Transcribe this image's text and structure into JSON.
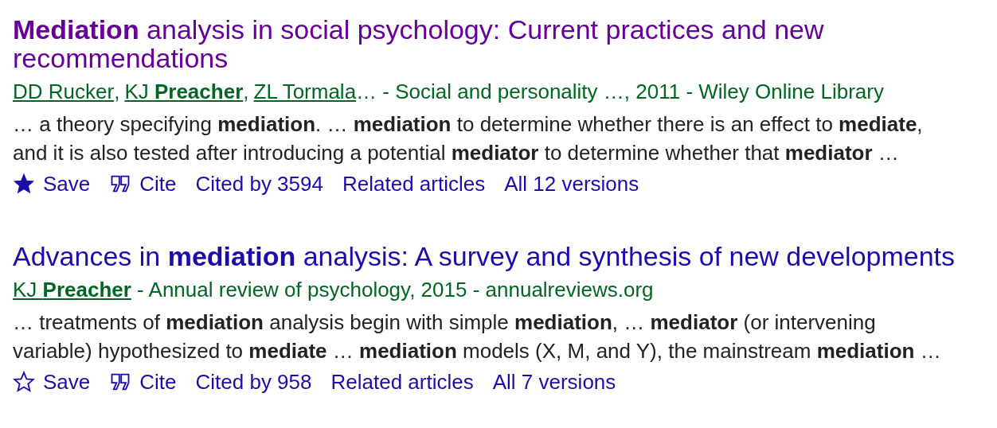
{
  "results": [
    {
      "title": "**Mediation** analysis in social psychology: Current practices and new recommendations",
      "visited": true,
      "authors": [
        {
          "name": "DD Rucker"
        },
        {
          "name": "KJ **Preacher**"
        },
        {
          "name": "ZL Tormala"
        }
      ],
      "author_separator": ",",
      "source": "… - Social and personality …, 2011 - Wiley Online Library",
      "snippet": "… a theory specifying **mediation**. … **mediation** to determine whether there is an effect to **mediate**, and it is also tested after introducing a potential **mediator** to determine whether that **mediator** …",
      "saved": true,
      "save_label": "Save",
      "cite_label": "Cite",
      "links": [
        "Cited by 3594",
        "Related articles",
        "All 12 versions"
      ]
    },
    {
      "title": "Advances in **mediation** analysis: A survey and synthesis of new developments",
      "visited": false,
      "authors": [
        {
          "name": "KJ **Preacher**"
        }
      ],
      "source": " - Annual review of psychology, 2015 - annualreviews.org",
      "snippet": "… treatments of **mediation** analysis begin with simple **mediation**, … **mediator** (or intervening variable) hypothesized to **mediate** … **mediation** models (X, M, and Y), the mainstream **mediation** …",
      "saved": false,
      "save_label": "Save",
      "cite_label": "Cite",
      "links": [
        "Cited by 958",
        "Related articles",
        "All 7 versions"
      ]
    }
  ]
}
